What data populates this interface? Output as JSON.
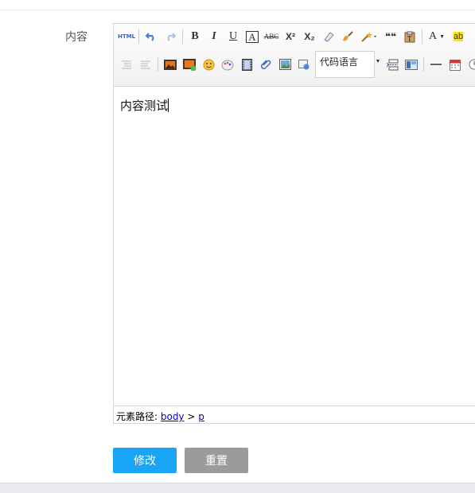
{
  "form": {
    "content_label": "内容",
    "submit_label": "修改",
    "reset_label": "重置"
  },
  "editor": {
    "toolbar": {
      "html_label": "HTML",
      "bold": "B",
      "italic": "I",
      "underline": "U",
      "fontborder": "A",
      "strikethrough": "ABC",
      "superscript": "X²",
      "subscript": "X₂",
      "quote": "❝❝",
      "forecolor": "A",
      "backcolor": "ab",
      "code_language": "代码语言"
    },
    "content_text": "内容测试",
    "status": {
      "path_label": "元素路径: ",
      "body_link": "body",
      "separator": " > ",
      "p_link": "p"
    }
  }
}
